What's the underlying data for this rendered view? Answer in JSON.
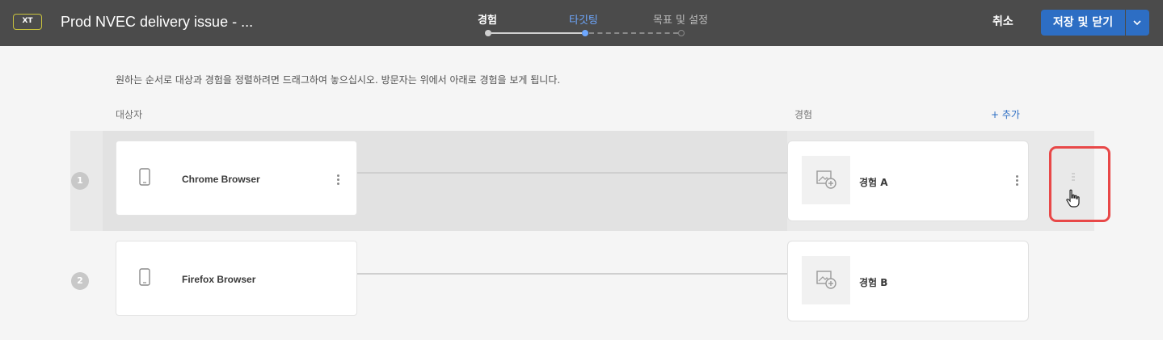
{
  "header": {
    "badge": "XT",
    "title": "Prod NVEC delivery issue - ...",
    "steps": [
      {
        "label": "경험",
        "state": "done"
      },
      {
        "label": "타깃팅",
        "state": "active"
      },
      {
        "label": "목표 및 설정",
        "state": "todo"
      }
    ],
    "cancel_label": "취소",
    "save_label": "저장 및 닫기"
  },
  "content": {
    "instruction": "원하는 순서로 대상과 경험을 정렬하려면 드래그하여 놓으십시오. 방문자는 위에서 아래로 경험을 보게 됩니다.",
    "audience_header": "대상자",
    "experience_header": "경험",
    "add_label": "+  추가",
    "rows": [
      {
        "number": "1",
        "audience": "Chrome Browser",
        "experience": "경험 A"
      },
      {
        "number": "2",
        "audience": "Firefox Browser",
        "experience": "경험 B"
      }
    ]
  },
  "colors": {
    "header_bg": "#4b4b4b",
    "accent_blue": "#2d6ec4",
    "active_step": "#6ea8ff",
    "highlight_red": "#e84848"
  }
}
